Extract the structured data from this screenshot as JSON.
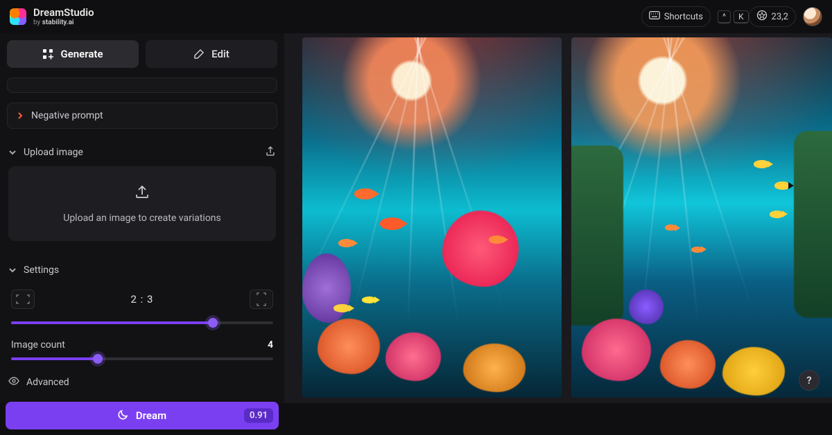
{
  "header": {
    "app_title": "DreamStudio",
    "subtitle_prefix": "by ",
    "subtitle_brand": "stability.ai",
    "shortcuts_label": "Shortcuts",
    "shortcut_keys": [
      "^",
      "K"
    ],
    "credits": "23,2"
  },
  "tabs": {
    "generate": "Generate",
    "edit": "Edit"
  },
  "negative_prompt": {
    "label": "Negative prompt"
  },
  "upload": {
    "heading": "Upload image",
    "placeholder": "Upload an image to create variations"
  },
  "settings": {
    "heading": "Settings",
    "ratio": "2 : 3",
    "ratio_slider_pct": 77,
    "image_count_label": "Image count",
    "image_count_value": "4",
    "image_count_slider_pct": 33,
    "advanced_label": "Advanced"
  },
  "dream": {
    "label": "Dream",
    "cost": "0.91"
  },
  "help": {
    "label": "?"
  }
}
